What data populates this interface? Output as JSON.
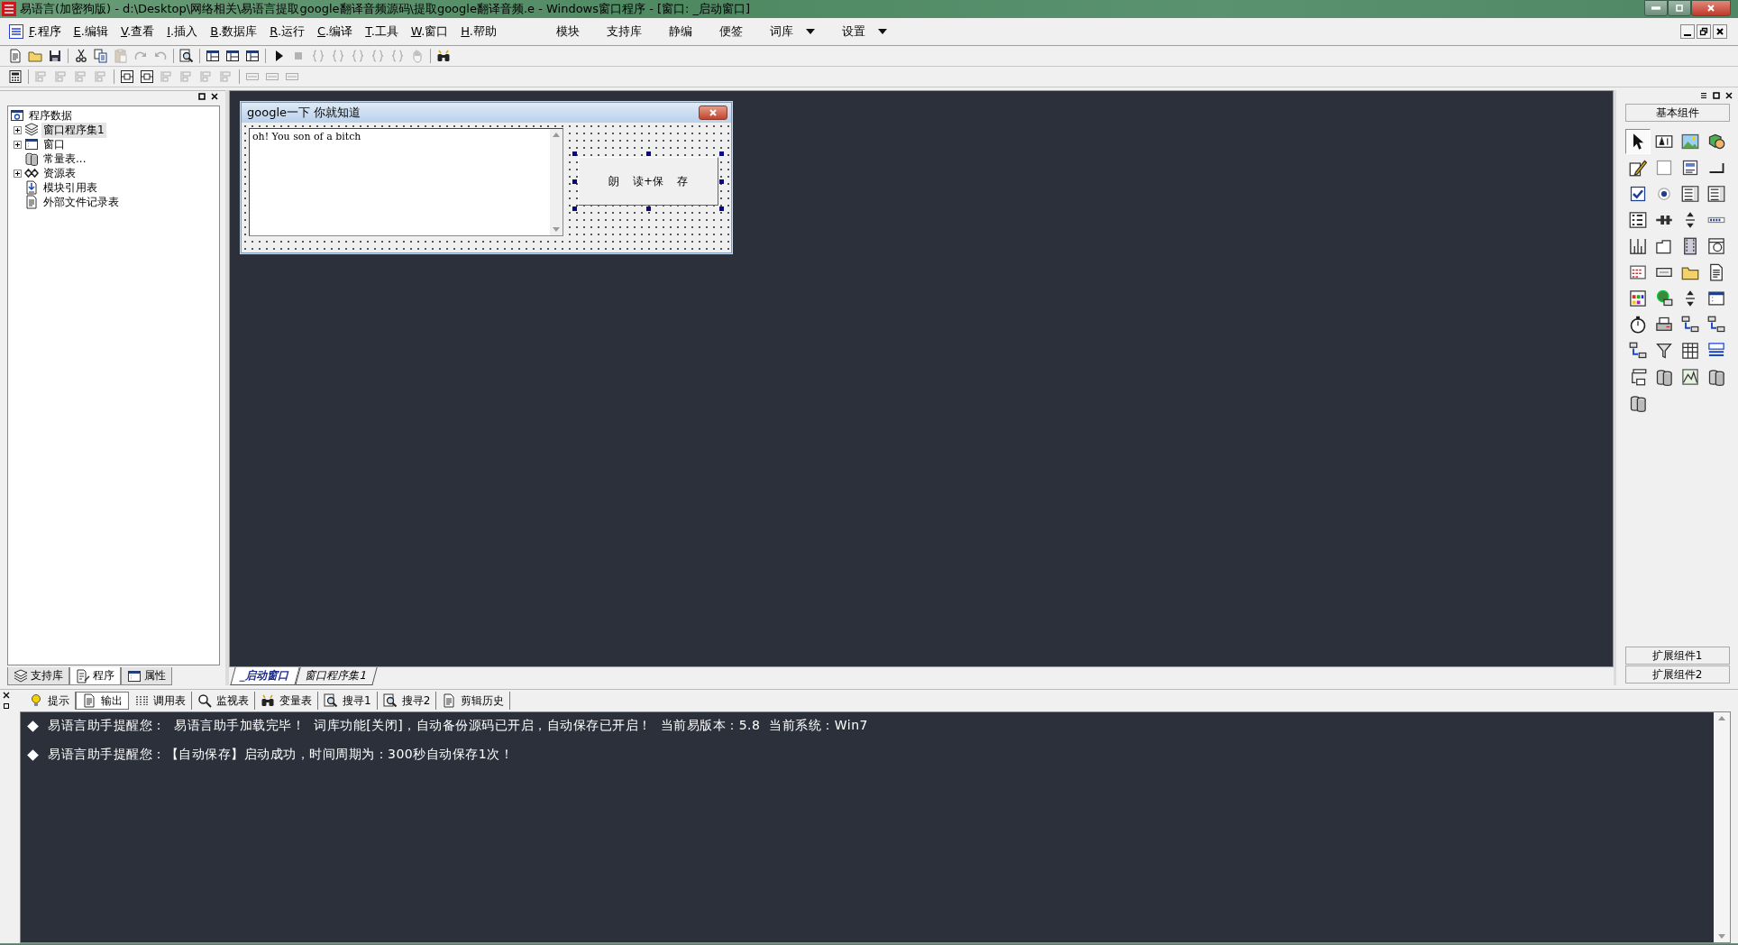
{
  "window": {
    "title": "易语言(加密狗版) - d:\\Desktop\\网络相关\\易语言提取google翻译音频源码\\提取google翻译音频.e - Windows窗口程序 - [窗口: _启动窗口]"
  },
  "menu": [
    {
      "label": "F.程序"
    },
    {
      "label": "E.编辑"
    },
    {
      "label": "V.查看"
    },
    {
      "label": "I.插入"
    },
    {
      "label": "B.数据库"
    },
    {
      "label": "R.运行"
    },
    {
      "label": "C.编译"
    },
    {
      "label": "T.工具"
    },
    {
      "label": "W.窗口"
    },
    {
      "label": "H.帮助"
    }
  ],
  "quick_menu": [
    {
      "label": "模块",
      "dropdown": false
    },
    {
      "label": "支持库",
      "dropdown": false
    },
    {
      "label": "静编",
      "dropdown": false
    },
    {
      "label": "便签",
      "dropdown": false
    },
    {
      "label": "词库",
      "dropdown": true
    },
    {
      "label": "设置",
      "dropdown": true
    }
  ],
  "toolbar_1": [
    {
      "kind": "document",
      "disabled": false
    },
    {
      "kind": "folder",
      "disabled": false
    },
    {
      "kind": "floppy",
      "disabled": false
    },
    {
      "kind": "separator"
    },
    {
      "kind": "scissors",
      "disabled": false
    },
    {
      "kind": "copy",
      "disabled": false
    },
    {
      "kind": "clipboard",
      "disabled": true
    },
    {
      "kind": "redo",
      "disabled": true
    },
    {
      "kind": "undo",
      "disabled": true
    },
    {
      "kind": "separator"
    },
    {
      "kind": "find",
      "disabled": false
    },
    {
      "kind": "separator"
    },
    {
      "kind": "layout",
      "disabled": false
    },
    {
      "kind": "layout",
      "disabled": false
    },
    {
      "kind": "layout",
      "disabled": false
    },
    {
      "kind": "separator"
    },
    {
      "kind": "play",
      "disabled": false
    },
    {
      "kind": "stop",
      "disabled": true
    },
    {
      "kind": "step",
      "disabled": true
    },
    {
      "kind": "step",
      "disabled": true
    },
    {
      "kind": "step",
      "disabled": true
    },
    {
      "kind": "step",
      "disabled": true
    },
    {
      "kind": "step",
      "disabled": true
    },
    {
      "kind": "hand",
      "disabled": true
    },
    {
      "kind": "separator"
    },
    {
      "kind": "binoculars",
      "disabled": false
    }
  ],
  "toolbar_2": [
    {
      "kind": "calculator",
      "disabled": false
    },
    {
      "kind": "separator"
    },
    {
      "kind": "align",
      "disabled": true
    },
    {
      "kind": "align",
      "disabled": true
    },
    {
      "kind": "align",
      "disabled": true
    },
    {
      "kind": "align",
      "disabled": true
    },
    {
      "kind": "separator"
    },
    {
      "kind": "center",
      "disabled": false
    },
    {
      "kind": "center",
      "disabled": false
    },
    {
      "kind": "align",
      "disabled": true
    },
    {
      "kind": "align",
      "disabled": true
    },
    {
      "kind": "align",
      "disabled": true
    },
    {
      "kind": "align",
      "disabled": true
    },
    {
      "kind": "separator"
    },
    {
      "kind": "resize",
      "disabled": true
    },
    {
      "kind": "resize",
      "disabled": true
    },
    {
      "kind": "resize",
      "disabled": true
    }
  ],
  "tree": {
    "label": "程序数据",
    "children": [
      {
        "label": "窗口程序集1",
        "kind": "module",
        "has_children": true,
        "selected": true
      },
      {
        "label": "窗口",
        "kind": "window",
        "has_children": true,
        "selected": false
      },
      {
        "label": "常量表...",
        "kind": "database",
        "has_children": false,
        "selected": false
      },
      {
        "label": "资源表",
        "kind": "resource",
        "has_children": true,
        "selected": false
      },
      {
        "label": "模块引用表",
        "kind": "import",
        "has_children": false,
        "selected": false
      },
      {
        "label": "外部文件记录表",
        "kind": "document",
        "has_children": false,
        "selected": false
      }
    ]
  },
  "left_tabs": [
    {
      "label": "支持库",
      "kind": "module",
      "selected": false
    },
    {
      "label": "程序",
      "kind": "program",
      "selected": true
    },
    {
      "label": "属性",
      "kind": "window",
      "selected": false
    }
  ],
  "form": {
    "title": "google一下 你就知道",
    "textbox": {
      "value": "oh! You son of a bitch"
    },
    "button": {
      "label": "朗    读+保    存",
      "selected": true
    }
  },
  "design_tabs": [
    {
      "label": "_启动窗口",
      "selected": true
    },
    {
      "label": "窗口程序集1",
      "selected": false
    }
  ],
  "toolbox": {
    "title": "基本组件",
    "tools": [
      {
        "kind": "pointer",
        "selected": true
      },
      {
        "kind": "label",
        "selected": false
      },
      {
        "kind": "picture",
        "selected": false
      },
      {
        "kind": "shape",
        "selected": false
      },
      {
        "kind": "pen",
        "selected": false
      },
      {
        "kind": "frame",
        "selected": false
      },
      {
        "kind": "text",
        "selected": false
      },
      {
        "kind": "line",
        "selected": false
      },
      {
        "kind": "checkbox",
        "selected": false
      },
      {
        "kind": "radio",
        "selected": false
      },
      {
        "kind": "listbox",
        "selected": false
      },
      {
        "kind": "listbox",
        "selected": false
      },
      {
        "kind": "list",
        "selected": false
      },
      {
        "kind": "slider",
        "selected": false
      },
      {
        "kind": "spinner",
        "selected": false
      },
      {
        "kind": "progress",
        "selected": false
      },
      {
        "kind": "ruler",
        "selected": false
      },
      {
        "kind": "tab",
        "selected": false
      },
      {
        "kind": "film",
        "selected": false
      },
      {
        "kind": "web",
        "selected": false
      },
      {
        "kind": "calendar",
        "selected": false
      },
      {
        "kind": "button",
        "selected": false
      },
      {
        "kind": "folder",
        "selected": false
      },
      {
        "kind": "document",
        "selected": false
      },
      {
        "kind": "palette",
        "selected": false
      },
      {
        "kind": "network",
        "selected": false
      },
      {
        "kind": "spinner",
        "selected": false
      },
      {
        "kind": "window",
        "selected": false
      },
      {
        "kind": "timer",
        "selected": false
      },
      {
        "kind": "printer",
        "selected": false
      },
      {
        "kind": "transfer",
        "selected": false
      },
      {
        "kind": "transfer",
        "selected": false
      },
      {
        "kind": "transfer",
        "selected": false
      },
      {
        "kind": "funnel",
        "selected": false
      },
      {
        "kind": "table",
        "selected": false
      },
      {
        "kind": "toolbar",
        "selected": false
      },
      {
        "kind": "tree",
        "selected": false
      },
      {
        "kind": "database",
        "selected": false
      },
      {
        "kind": "chart",
        "selected": false
      },
      {
        "kind": "database",
        "selected": false
      },
      {
        "kind": "database",
        "selected": false
      }
    ],
    "extensions": [
      "扩展组件1",
      "扩展组件2"
    ]
  },
  "output_tabs": [
    {
      "label": "提示",
      "kind": "bulb",
      "selected": false
    },
    {
      "label": "输出",
      "kind": "document",
      "selected": true
    },
    {
      "label": "调用表",
      "kind": "dots",
      "selected": false
    },
    {
      "label": "监视表",
      "kind": "magnifier",
      "selected": false
    },
    {
      "label": "变量表",
      "kind": "binoculars",
      "selected": false
    },
    {
      "label": "搜寻1",
      "kind": "find",
      "selected": false
    },
    {
      "label": "搜寻2",
      "kind": "find",
      "selected": false
    },
    {
      "label": "剪辑历史",
      "kind": "document",
      "selected": false
    }
  ],
  "output_lines": [
    "易语言助手提醒您：  易语言助手加载完毕！  词库功能[关闭]，自动备份源码已开启，自动保存已开启！  当前易版本：5.8  当前系统：Win7",
    "易语言助手提醒您：【自动保存】启动成功，时间周期为：300秒自动保存1次！"
  ]
}
